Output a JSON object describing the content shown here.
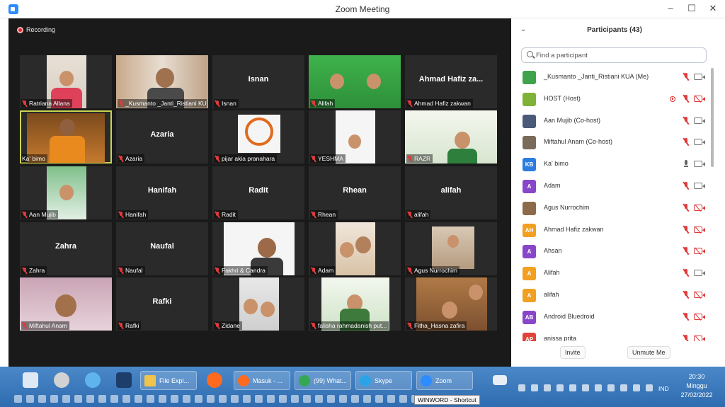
{
  "window": {
    "title": "Zoom Meeting"
  },
  "recording": {
    "label": "Recording"
  },
  "tiles": [
    {
      "name": "Ratriana Allana",
      "big": ""
    },
    {
      "name": "_Kusmanto _Janti_Ristiani KUA",
      "big": ""
    },
    {
      "name": "Isnan",
      "big": "Isnan"
    },
    {
      "name": "Alifah",
      "big": ""
    },
    {
      "name": "Ahmad Hafiz zakwan",
      "big": "Ahmad Hafiz za..."
    },
    {
      "name": "Ka' bimo",
      "big": ""
    },
    {
      "name": "Azaria",
      "big": "Azaria"
    },
    {
      "name": "pijar akia pranahara",
      "big": ""
    },
    {
      "name": "YESHMA",
      "big": ""
    },
    {
      "name": "RAZR",
      "big": ""
    },
    {
      "name": "Aan Mujib",
      "big": ""
    },
    {
      "name": "Hanifah",
      "big": "Hanifah"
    },
    {
      "name": "Radit",
      "big": "Radit"
    },
    {
      "name": "Rhean",
      "big": "Rhean"
    },
    {
      "name": "alifah",
      "big": "alifah"
    },
    {
      "name": "Zahra",
      "big": "Zahra"
    },
    {
      "name": "Naufal ",
      "big": "Naufal "
    },
    {
      "name": "Fakhri & Candra",
      "big": ""
    },
    {
      "name": "Adam",
      "big": ""
    },
    {
      "name": "Agus Nurrochim",
      "big": ""
    },
    {
      "name": "Miftahul Anam",
      "big": ""
    },
    {
      "name": "Rafki",
      "big": "Rafki"
    },
    {
      "name": "Zidane",
      "big": ""
    },
    {
      "name": "falisha rahmadanish put...",
      "big": ""
    },
    {
      "name": "Fitha_Hasna zafira",
      "big": ""
    }
  ],
  "participants_panel": {
    "title": "Participants (43)",
    "search_placeholder": "Find a participant",
    "items": [
      {
        "name": "_Kusmanto _Janti_Ristiani KUA (Me)",
        "initials": "",
        "color": "#3fa34d",
        "mic": "off",
        "cam": "on"
      },
      {
        "name": "HOST (Host)",
        "initials": "",
        "color": "#7fb236",
        "mic": "off",
        "cam": "off",
        "recording": true
      },
      {
        "name": "Aan Mujib (Co-host)",
        "initials": "",
        "color": "#4b5a78",
        "mic": "off",
        "cam": "on"
      },
      {
        "name": "Miftahul Anam (Co-host)",
        "initials": "",
        "color": "#7a6a5a",
        "mic": "off",
        "cam": "on"
      },
      {
        "name": "Ka' bimo",
        "initials": "KB",
        "color": "#2b7de0",
        "mic": "on",
        "cam": "on"
      },
      {
        "name": "Adam",
        "initials": "A",
        "color": "#8a46c9",
        "mic": "off",
        "cam": "on"
      },
      {
        "name": "Agus Nurrochim",
        "initials": "",
        "color": "#8c6b4a",
        "mic": "off",
        "cam": "off"
      },
      {
        "name": "Ahmad Hafiz zakwan",
        "initials": "AH",
        "color": "#f2a021",
        "mic": "off",
        "cam": "off"
      },
      {
        "name": "Ahsan",
        "initials": "A",
        "color": "#8a46c9",
        "mic": "off",
        "cam": "off"
      },
      {
        "name": "Alifah",
        "initials": "A",
        "color": "#f2a021",
        "mic": "off",
        "cam": "on"
      },
      {
        "name": "alifah",
        "initials": "A",
        "color": "#f2a021",
        "mic": "off",
        "cam": "off"
      },
      {
        "name": "Android Bluedroid",
        "initials": "AB",
        "color": "#8a46c9",
        "mic": "off",
        "cam": "off"
      },
      {
        "name": "anissa prita",
        "initials": "AP",
        "color": "#e0433a",
        "mic": "off",
        "cam": "off"
      }
    ],
    "invite_label": "Invite",
    "unmute_label": "Unmute Me"
  },
  "taskbar": {
    "buttons": [
      {
        "label": "File Expl...",
        "color": "#f0c44c"
      },
      {
        "label": "Masuk - ...",
        "color": "#ff6a1f"
      },
      {
        "label": "(99) What...",
        "color": "#34a853"
      },
      {
        "label": "Skype",
        "color": "#2aa4e8"
      },
      {
        "label": "Zoom",
        "color": "#2d8cff"
      }
    ],
    "tooltip": "WINWORD - Shortcut",
    "language": "IND",
    "time": "20:30",
    "day": "Minggu",
    "date": "27/02/2022"
  }
}
